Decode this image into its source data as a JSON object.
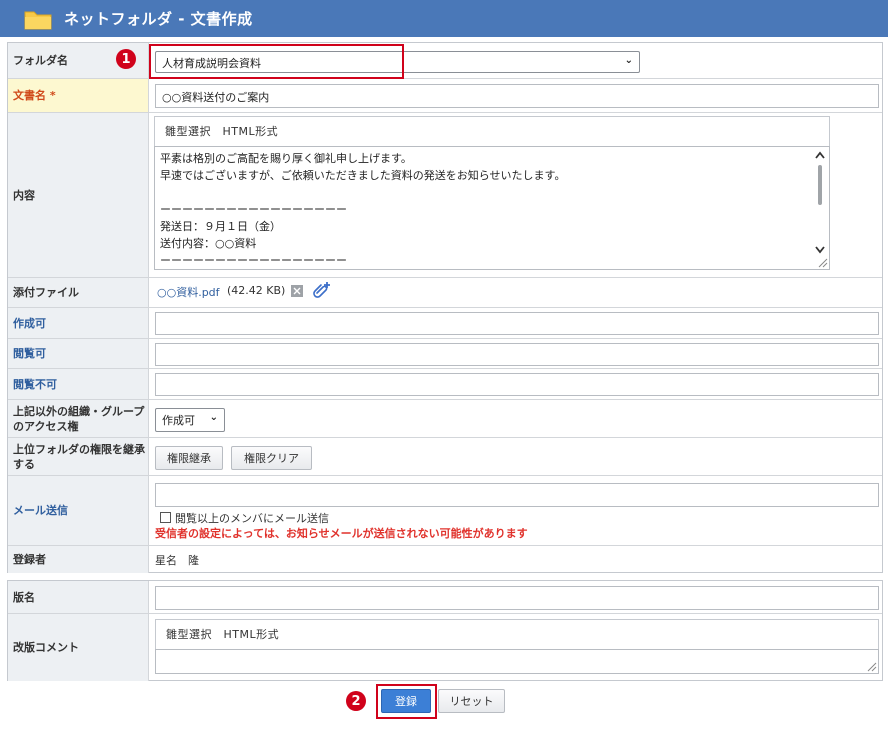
{
  "header": {
    "title": "ネットフォルダ - 文書作成"
  },
  "form": {
    "folder": {
      "label": "フォルダ名",
      "value": "人材育成説明会資料"
    },
    "docname": {
      "label": "文書名 *",
      "value": "○○資料送付のご案内"
    },
    "content": {
      "label": "内容",
      "editor_tab": "雛型選択　HTML形式",
      "lines": [
        "平素は格別のご高配を賜り厚く御礼申し上げます。",
        "早速ではございますが、ご依頼いただきました資料の発送をお知らせいたします。",
        "",
        "ーーーーーーーーーーーーーーーーー",
        "発送日：９月１日（金）",
        "送付内容：○○資料",
        "ーーーーーーーーーーーーーーーーー"
      ]
    },
    "attachment": {
      "label": "添付ファイル",
      "file_name": "○○資料.pdf",
      "file_size": "(42.42 KB)"
    },
    "can_create": {
      "label": "作成可",
      "value": ""
    },
    "can_view": {
      "label": "閲覧可",
      "value": ""
    },
    "cannot_view": {
      "label": "閲覧不可",
      "value": ""
    },
    "other_access": {
      "label": "上記以外の組織・グループのアクセス権",
      "value": "作成可"
    },
    "inherit": {
      "label": "上位フォルダの権限を継承する",
      "btn_inherit": "権限継承",
      "btn_clear": "権限クリア"
    },
    "mail": {
      "label": "メール送信",
      "value": "",
      "checkbox_label": "閲覧以上のメンバにメール送信",
      "warning": "受信者の設定によっては、お知らせメールが送信されない可能性があります"
    },
    "registrant": {
      "label": "登録者",
      "value": "星名　隆"
    }
  },
  "version": {
    "name": {
      "label": "版名",
      "value": ""
    },
    "comment": {
      "label": "改版コメント",
      "editor_tab": "雛型選択　HTML形式"
    }
  },
  "actions": {
    "submit": "登録",
    "reset": "リセット"
  },
  "callouts": {
    "one": "1",
    "two": "2"
  },
  "colors": {
    "header": "#4a78b8",
    "callout": "#d0021b",
    "primary": "#3c7fd6",
    "warning": "#e0322c"
  }
}
